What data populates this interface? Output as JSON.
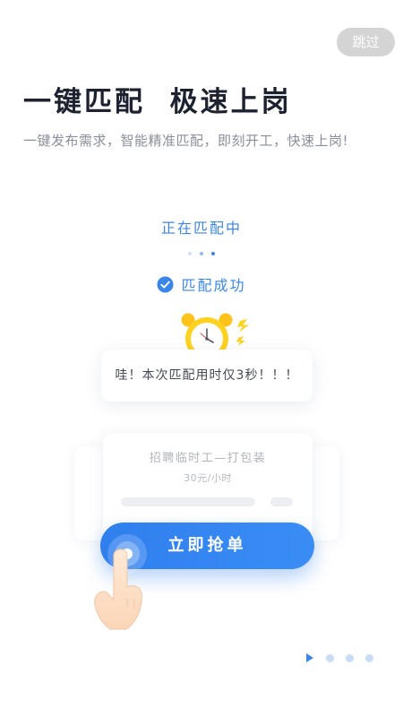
{
  "skip_label": "跳过",
  "headline": "一键匹配  极速上岗",
  "subtitle": "一键发布需求，智能精准匹配，即刻开工，快速上岗!",
  "matching": {
    "status_text": "正在匹配中",
    "success_text": "匹配成功"
  },
  "bubble_text": "哇！本次匹配用时仅3秒！！！",
  "job_card": {
    "title": "招聘临时工—打包装",
    "pay": "30元/小时"
  },
  "grab_button_label": "立即抢单",
  "pager": {
    "total": 4,
    "current": 1
  },
  "colors": {
    "accent": "#3A86E8",
    "skip_bg": "#D4D4D4",
    "headline": "#1C2230",
    "clock_yellow": "#FFD21F"
  },
  "icons": [
    "check-circle-icon",
    "alarm-clock-icon",
    "lightning-icon",
    "hand-pointer-icon",
    "play-icon"
  ]
}
